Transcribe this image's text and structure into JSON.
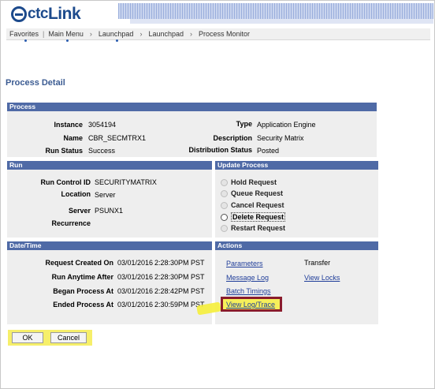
{
  "header": {
    "logo_prefix": "ctc",
    "logo_suffix": "Link",
    "logo_icon": "ctclink-logo-icon"
  },
  "nav": {
    "items": [
      "Favorites",
      "Main Menu",
      "Launchpad",
      "Launchpad",
      "Process Monitor"
    ]
  },
  "page_title": "Process Detail",
  "process": {
    "header": "Process",
    "instance_label": "Instance",
    "instance_value": "3054194",
    "name_label": "Name",
    "name_value": "CBR_SECMTRX1",
    "run_status_label": "Run Status",
    "run_status_value": "Success",
    "type_label": "Type",
    "type_value": "Application Engine",
    "description_label": "Description",
    "description_value": "Security Matrix",
    "dist_status_label": "Distribution Status",
    "dist_status_value": "Posted"
  },
  "run": {
    "header": "Run",
    "run_control_label": "Run Control ID",
    "run_control_value": "SECURITYMATRIX",
    "location_label": "Location",
    "location_value": "Server",
    "server_label": "Server",
    "server_value": "PSUNX1",
    "recurrence_label": "Recurrence",
    "recurrence_value": ""
  },
  "update_process": {
    "header": "Update Process",
    "options": [
      "Hold Request",
      "Queue Request",
      "Cancel Request",
      "Delete Request",
      "Restart Request"
    ],
    "selected_index": 3
  },
  "datetime": {
    "header": "Date/Time",
    "rows": [
      {
        "label": "Request Created On",
        "date": "03/01/2016",
        "time": "2:28:30PM PST"
      },
      {
        "label": "Run Anytime After",
        "date": "03/01/2016",
        "time": "2:28:30PM PST"
      },
      {
        "label": "Began Process At",
        "date": "03/01/2016",
        "time": "2:28:42PM PST"
      },
      {
        "label": "Ended Process At",
        "date": "03/01/2016",
        "time": "2:30:59PM PST"
      }
    ]
  },
  "actions": {
    "header": "Actions",
    "parameters": "Parameters",
    "transfer": "Transfer",
    "message_log": "Message Log",
    "view_locks": "View Locks",
    "batch_timings": "Batch Timings",
    "view_log_trace": "View Log/Trace"
  },
  "buttons": {
    "ok": "OK",
    "cancel": "Cancel"
  },
  "colors": {
    "section_header": "#4f6aa6",
    "section_body": "#eeeeee",
    "link": "#1f3d99",
    "highlight_border": "#8a1c2c",
    "highlight_fill": "#f6ef5a",
    "title": "#3b5b92"
  }
}
